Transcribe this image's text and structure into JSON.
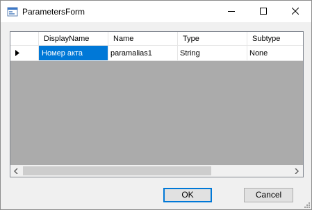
{
  "window": {
    "title": "ParametersForm",
    "icon": "app-form-icon",
    "controls": [
      "minimize-icon",
      "maximize-icon",
      "close-icon"
    ]
  },
  "grid": {
    "columns": [
      "DisplayName",
      "Name",
      "Type",
      "Subtype"
    ],
    "rows": [
      {
        "current": true,
        "cells": [
          "Номер акта",
          "paramalias1",
          "String",
          "None"
        ]
      }
    ],
    "selected_color": "#0078d7",
    "empty_area_color": "#ababab"
  },
  "buttons": {
    "ok": "OK",
    "cancel": "Cancel"
  },
  "accent": "#0078d7"
}
